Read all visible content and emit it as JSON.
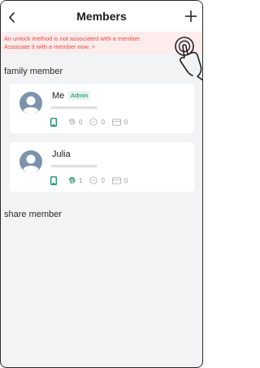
{
  "header": {
    "title": "Members",
    "back_icon": "chevron-left-icon",
    "add_icon": "plus-icon"
  },
  "banner": {
    "line1": "An unlock method is not associated with a member.",
    "line2": "Associate it with a member now. >"
  },
  "sections": {
    "family_title": "family member",
    "share_title": "share member"
  },
  "members": [
    {
      "name": "Me",
      "badge": "Admin",
      "counts": {
        "fingerprint": "0",
        "password": "0",
        "card": "0"
      }
    },
    {
      "name": "Julia",
      "counts": {
        "fingerprint": "1",
        "password": "0",
        "card": "0"
      }
    }
  ],
  "colors": {
    "accent": "#0b8a5e",
    "warning_text": "#ea4a43",
    "warning_bg": "#fdecec",
    "avatar": "#7c93ad"
  }
}
